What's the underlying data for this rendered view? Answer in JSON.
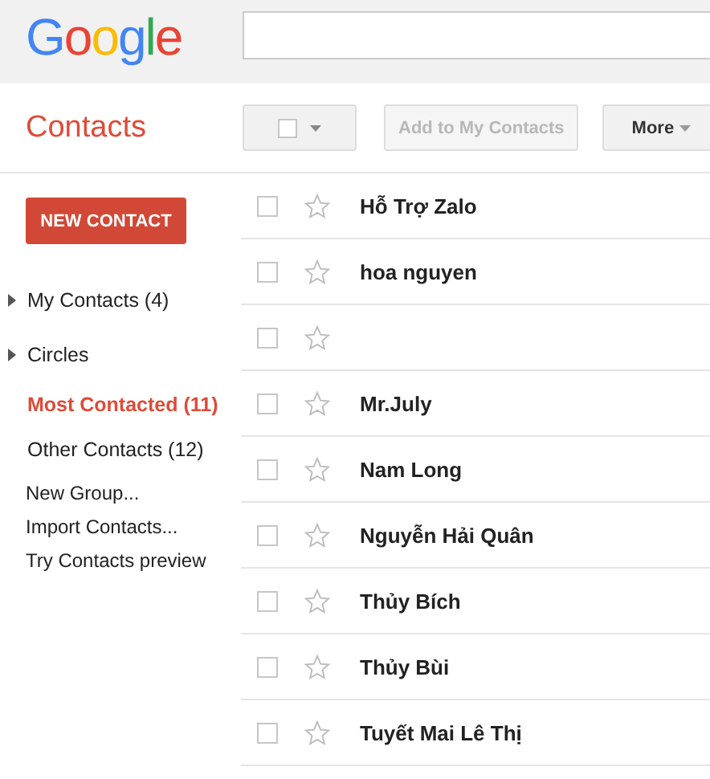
{
  "header": {
    "logo": "Google"
  },
  "app_title": "Contacts",
  "toolbar": {
    "select": {
      "checked": false
    },
    "add_button": {
      "label": "Add to My Contacts",
      "disabled": true
    },
    "more_button": {
      "label": "More"
    }
  },
  "sidebar": {
    "new_button": "NEW CONTACT",
    "groups": [
      {
        "label": "My Contacts (4)",
        "expanded": false,
        "selected": false
      },
      {
        "label": "Circles",
        "expanded": false,
        "selected": false
      },
      {
        "label": "Most Contacted (11)",
        "selected": true
      },
      {
        "label": "Other Contacts (12)",
        "selected": false
      }
    ],
    "actions": [
      "New Group...",
      "Import Contacts...",
      "Try Contacts preview"
    ]
  },
  "contacts": [
    {
      "name": "Hỗ Trợ Zalo",
      "checked": false,
      "starred": false
    },
    {
      "name": "hoa nguyen",
      "checked": false,
      "starred": false
    },
    {
      "checked": false,
      "starred": false
    },
    {
      "name": "Mr.July",
      "checked": false,
      "starred": false
    },
    {
      "name": "Nam Long",
      "checked": false,
      "starred": false
    },
    {
      "name": "Nguyễn Hải Quân",
      "checked": false,
      "starred": false
    },
    {
      "name": "Thủy Bích",
      "checked": false,
      "starred": false
    },
    {
      "name": "Thủy Bùi",
      "checked": false,
      "starred": false
    },
    {
      "name": "Tuyết Mai Lê Thị",
      "checked": false,
      "starred": false
    }
  ]
}
